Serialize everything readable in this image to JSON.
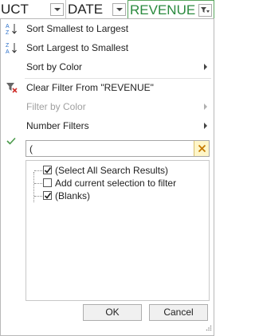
{
  "header": {
    "columns": [
      {
        "label": "UCT"
      },
      {
        "label": "DATE"
      },
      {
        "label": "REVENUE"
      }
    ]
  },
  "menu": {
    "sort_smallest": "Sort Smallest to Largest",
    "sort_largest": "Sort Largest to Smallest",
    "sort_by_color": "Sort by Color",
    "clear_filter": "Clear Filter From \"REVENUE\"",
    "filter_by_color": "Filter by Color",
    "number_filters": "Number Filters"
  },
  "search": {
    "value": "("
  },
  "list": {
    "items": [
      {
        "label": "(Select All Search Results)",
        "checked": true
      },
      {
        "label": "Add current selection to filter",
        "checked": false
      },
      {
        "label": "(Blanks)",
        "checked": true
      }
    ]
  },
  "buttons": {
    "ok": "OK",
    "cancel": "Cancel"
  },
  "colors": {
    "revenue_header": "#2a8a3e",
    "clear_button_bg": "#fff6c8",
    "checkmark": "#4a9a4a"
  }
}
